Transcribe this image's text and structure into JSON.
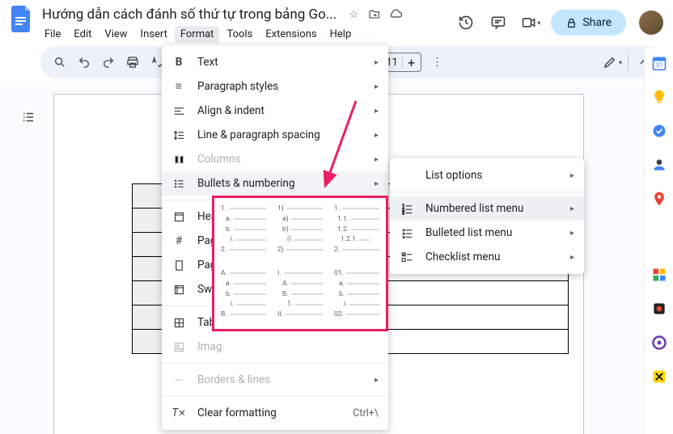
{
  "doc": {
    "title": "Hướng dẫn cách đánh số thứ tự trong bảng Go..."
  },
  "menus": {
    "file": "File",
    "edit": "Edit",
    "view": "View",
    "insert": "Insert",
    "format": "Format",
    "tools": "Tools",
    "extensions": "Extensions",
    "help": "Help"
  },
  "share": {
    "label": "Share"
  },
  "font_size": "11",
  "format_menu": {
    "text": "Text",
    "paragraph_styles": "Paragraph styles",
    "align_indent": "Align & indent",
    "line_paragraph_spacing": "Line & paragraph spacing",
    "columns": "Columns",
    "bullets_numbering": "Bullets & numbering",
    "hea": "Hea",
    "page": "Page",
    "page2": "Page",
    "swit": "Swit",
    "tabl": "Tabl",
    "imag": "Imag",
    "borders_lines": "Borders & lines",
    "clear_formatting": "Clear formatting",
    "clear_shortcut": "Ctrl+\\"
  },
  "submenu": {
    "list_options": "List options",
    "numbered_list": "Numbered list menu",
    "bulleted_list": "Bulleted list menu",
    "checklist": "Checklist menu"
  },
  "list_presets": {
    "r0c0": [
      "1.",
      "a.",
      "b.",
      "i.",
      "2."
    ],
    "r0c1": [
      "1)",
      "a)",
      "b)",
      "i)",
      "2)"
    ],
    "r0c2": [
      "1.",
      "1.1.",
      "1.2.",
      "1.2.1.",
      "2."
    ],
    "r1c0": [
      "A.",
      "a.",
      "b.",
      "i.",
      "B."
    ],
    "r1c1": [
      "I.",
      "A.",
      "B.",
      "1.",
      "II."
    ],
    "r1c2": [
      "01.",
      "a.",
      "b.",
      "i.",
      "02."
    ]
  }
}
